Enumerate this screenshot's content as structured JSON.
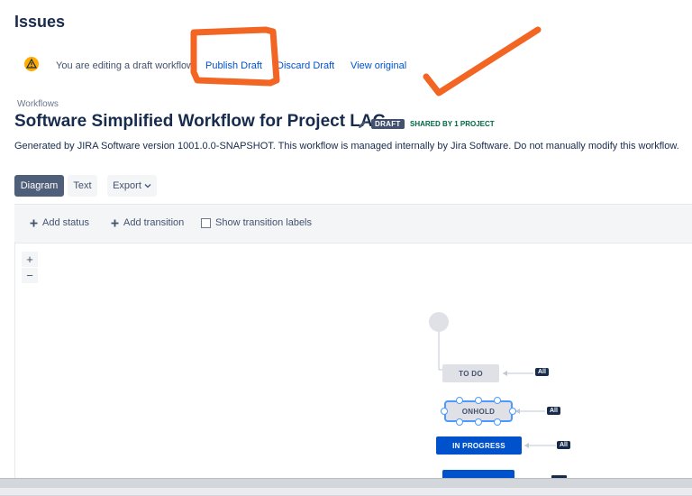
{
  "header": {
    "title": "Issues"
  },
  "draft_bar": {
    "icon": "warning-icon",
    "message": "You are editing a draft workflow.",
    "publish_label": "Publish Draft",
    "discard_label": "Discard Draft",
    "view_original_label": "View original"
  },
  "breadcrumb": "Workflows",
  "workflow": {
    "title": "Software Simplified Workflow for Project LAG",
    "status_lozenge": "DRAFT",
    "shared_label": "SHARED BY 1 PROJECT",
    "description": "Generated by JIRA Software version 1001.0.0-SNAPSHOT. This workflow is managed internally by Jira Software. Do not manually modify this workflow."
  },
  "view_buttons": {
    "diagram": "Diagram",
    "text": "Text",
    "export": "Export"
  },
  "toolbar": {
    "add_status": "Add status",
    "add_transition": "Add transition",
    "show_labels": "Show transition labels",
    "show_labels_checked": false
  },
  "zoom": {
    "in": "+",
    "out": "−"
  },
  "diagram": {
    "statuses": [
      {
        "name": "TO DO",
        "global_transition": "All"
      },
      {
        "name": "ONHOLD",
        "global_transition": "All"
      },
      {
        "name": "IN PROGRESS",
        "global_transition": "All"
      },
      {
        "name": "",
        "global_transition": ""
      }
    ]
  },
  "colors": {
    "link": "#0052cc",
    "annotation": "#f26522",
    "in_progress": "#0052cc",
    "todo": "#dfe1e6"
  }
}
